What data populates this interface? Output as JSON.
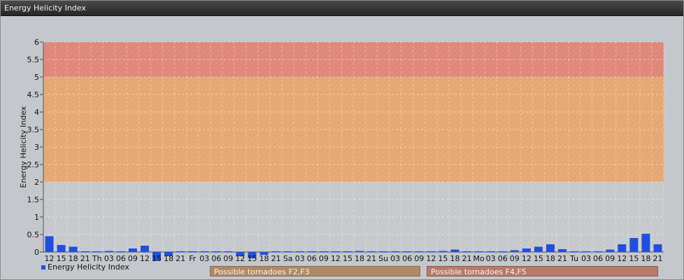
{
  "window": {
    "title": "Energy Helicity Index"
  },
  "legend": {
    "label": "Energy Helicity Index"
  },
  "zones": [
    {
      "label": "Possible tornadoes F2,F3",
      "color": "#b08963"
    },
    {
      "label": "Possible tornadoes F4,F5",
      "color": "#b87a6a"
    }
  ],
  "colors": {
    "bar": "#1f4fe0",
    "band_high": "#e0877a",
    "band_mid": "#e6a872",
    "band_low": "#c6c9cc"
  },
  "chart_data": {
    "type": "bar",
    "ylabel": "Energy Helicity Index",
    "ylim": [
      0,
      6
    ],
    "yticks": [
      "0",
      "0.5",
      "1",
      "1.5",
      "2",
      "2.5",
      "3",
      "3.5",
      "4",
      "4.5",
      "5",
      "5.5",
      "6"
    ],
    "bands": [
      {
        "from": 2,
        "to": 5,
        "color": "#e6a872"
      },
      {
        "from": 5,
        "to": 6,
        "color": "#e0877a"
      }
    ],
    "categories": [
      "12",
      "15",
      "18",
      "21",
      "Th",
      "03",
      "06",
      "09",
      "12",
      "15",
      "18",
      "21",
      "Fr",
      "03",
      "06",
      "09",
      "12",
      "15",
      "18",
      "21",
      "Sa",
      "03",
      "06",
      "09",
      "12",
      "15",
      "18",
      "21",
      "Su",
      "03",
      "06",
      "09",
      "12",
      "15",
      "18",
      "21",
      "Mo",
      "03",
      "06",
      "09",
      "12",
      "15",
      "18",
      "21",
      "Tu",
      "03",
      "06",
      "09",
      "12",
      "15",
      "18",
      "21"
    ],
    "series": [
      {
        "name": "Energy Helicity Index",
        "values": [
          0.45,
          0.2,
          0.15,
          0.02,
          0.02,
          0.03,
          0.02,
          0.1,
          0.18,
          -0.25,
          -0.12,
          0.02,
          0.02,
          0.02,
          0.02,
          0.02,
          -0.12,
          -0.18,
          -0.08,
          0.02,
          0.02,
          0.02,
          0.02,
          0.02,
          0.02,
          0.02,
          0.03,
          0.02,
          0.02,
          0.02,
          0.02,
          0.02,
          0.02,
          0.03,
          0.07,
          0.02,
          0.02,
          0.02,
          0.02,
          0.05,
          0.1,
          0.15,
          0.22,
          0.08,
          0.02,
          0.02,
          0.02,
          0.07,
          0.22,
          0.4,
          0.52,
          0.22
        ]
      }
    ]
  }
}
